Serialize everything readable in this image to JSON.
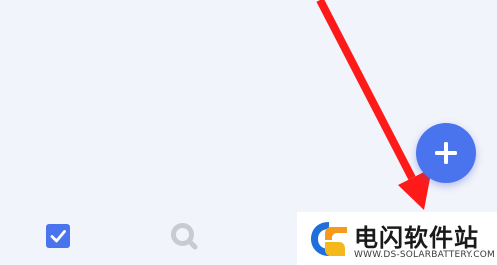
{
  "screen": {
    "background": "#f2f4fb"
  },
  "fab": {
    "icon": "plus-icon",
    "color": "#4a74ee"
  },
  "bottom_nav": {
    "items": [
      {
        "icon": "checkbox-icon",
        "color": "#4a74ee",
        "active": true
      },
      {
        "icon": "search-icon",
        "color": "#c9cbd2",
        "active": false
      }
    ]
  },
  "annotation": {
    "color": "#ff1a1a",
    "icon": "red-arrow"
  },
  "watermark": {
    "title": "电闪软件站",
    "url": "WWW.DS-SOLARBATTERY.COM"
  }
}
